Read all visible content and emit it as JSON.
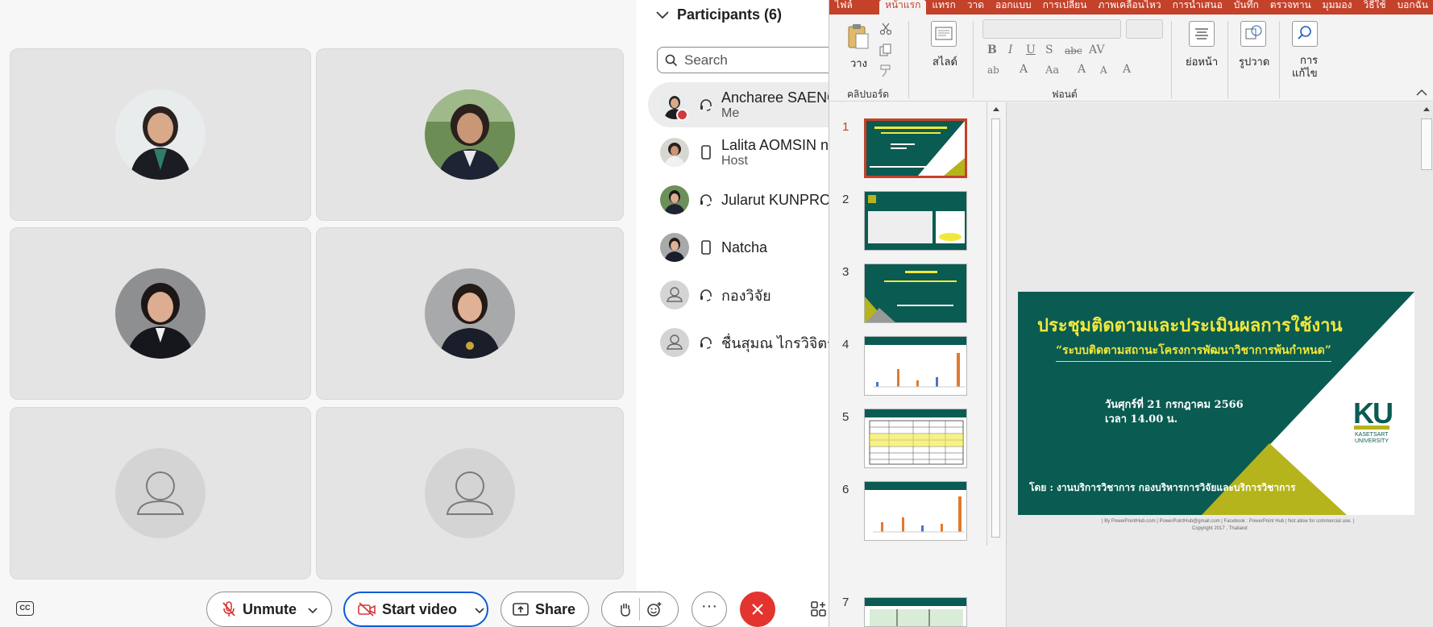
{
  "participants": {
    "title": "Participants (6)",
    "search_placeholder": "Search",
    "list": [
      {
        "name": "Ancharee SAENG",
        "role": "Me"
      },
      {
        "name": "Lalita AOMSIN n",
        "role": "Host"
      },
      {
        "name": "Jularut KUNPRO",
        "role": ""
      },
      {
        "name": "Natcha",
        "role": ""
      },
      {
        "name": "กองวิจัย",
        "role": ""
      },
      {
        "name": "ชื่นสุมณ ไกรวิจิตร",
        "role": ""
      }
    ]
  },
  "controls": {
    "unmute": "Unmute",
    "start_video": "Start video",
    "share": "Share"
  },
  "ppt": {
    "tabs": [
      "ไฟล์",
      "หน้าแรก",
      "แทรก",
      "วาด",
      "ออกแบบ",
      "การเปลี่ยน",
      "ภาพเคลื่อนไหว",
      "การนำเสนอ",
      "บันทึก",
      "ตรวจทาน",
      "มุมมอง",
      "วิธีใช้",
      "บอกฉัน"
    ],
    "ribbon": {
      "paste": "วาง",
      "clipboard": "คลิปบอร์ด",
      "slides": "สไลด์",
      "font": "ฟอนต์",
      "paragraph": "ย่อหน้า",
      "drawing": "รูปวาด",
      "editing_1": "การ",
      "editing_2": "แก้ไข"
    },
    "slide_numbers": [
      "1",
      "2",
      "3",
      "4",
      "5",
      "6",
      "7"
    ],
    "slide": {
      "title": "ประชุมติดตามและประเมินผลการใช้งาน",
      "subtitle": "“ระบบติดตามสถานะโครงการพัฒนาวิชาการพ้นกำหนด”",
      "date_line1": "วันศุกร์ที่ 21  กรกฎาคม 2566",
      "date_line2": "เวลา 14.00 น.",
      "by": "โดย : งานบริการวิชาการ  กองบริหารการวิจัยและบริการวิชาการ",
      "logo": "KU",
      "logo_name_1": "KASETSART",
      "logo_name_2": "UNIVERSITY",
      "credit_1": "| By PowerPointHub.com | PowerPointHub@gmail.com | Facebook : PowerPoint Hub | Not allow for commercial use. |",
      "credit_2": "Copyright 2017 , Thailand"
    }
  },
  "colors": {
    "slide_green": "#0a5b52",
    "slide_olive": "#b5b41c",
    "slide_yellow": "#f2e83a",
    "ppt_accent": "#c4412a",
    "end_call": "#e3342f",
    "webex_blue": "#0b5cd6"
  }
}
